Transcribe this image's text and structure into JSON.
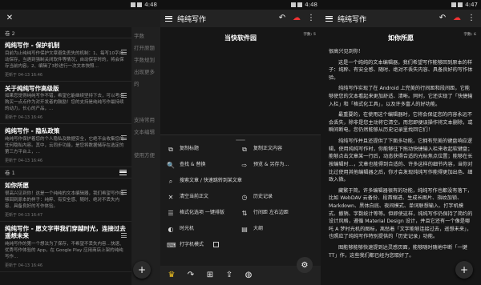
{
  "panel1": {
    "status_time": "4:48",
    "close_icon": "close-icon",
    "vol2_label": "卷 2",
    "vol1_label": "卷 1",
    "notes_vol2": [
      {
        "title": "纯纯写作 - 保护机制",
        "body": "目前为止纯纯写作保护文章避免丢失的机制：1、每写10字自动保存，当遇到强制关闭软件等情况，自动保存时的，将会保存当前内容。2、编辑了3秒进行一次文本快照…",
        "date": "更新于 04-13 16:46"
      },
      {
        "title": "关于纯纯写作高级版",
        "body": "如果您觉得纯纯写作不错，希望它能继续坚持下去，可以考虑购买一点点作为对开发者的鼓励！您的支持是纯纯写作最持续的动力，长心的产品，…",
        "date": "更新于 04-13 16:46"
      },
      {
        "title": "纯纯写作 - 隐私政策",
        "body": "纯纯写作保护着您的个人隐私及数据安全，它绝不会收集您的任何隐私内容。其中，云同步功能，是您将数据储存在选定的第三方平台上，…",
        "date": "更新于 04-13 16:46"
      }
    ],
    "notes_vol1": [
      {
        "title": "如你所愿",
        "body": "很高兴见到你！这是一个纯纯的文本编辑器，我们希望写作能够回到原本的样子：纯粹、有安全感、随时、绝对不丢失内容、具备良好的写作体验。",
        "date": "更新于 04-13 16:47"
      },
      {
        "title": "纯纯写作 - 愿文字带我们穿越时光，连接过去遥想未来",
        "body": "纯纯写作的第一个想法为了保存，不希望不丢失内容…快速、优秀写作体验的 App，在 Google Play 应用商店上架的纯纯写作…",
        "date": "更新于 04-13 16:46"
      }
    ],
    "peek_items": [
      "字数",
      "打开原题",
      "字数规划",
      "出现更多的",
      "",
      "",
      "支持常用文本编辑",
      "",
      "使用方便"
    ],
    "fab_label": "+"
  },
  "panel2": {
    "status_time": "4:48",
    "app_title": "纯纯写作",
    "doc_title": "当快软件园",
    "word_count": "字数: 5",
    "tools": [
      {
        "icon": "⧉",
        "icon_name": "copy-title-icon",
        "label": "复制标题"
      },
      {
        "icon": "⧉",
        "icon_name": "copy-body-icon",
        "label": "复制正文内容"
      },
      {
        "icon": "🔍",
        "icon_name": "find-replace-icon",
        "label": "查找 & 替换"
      },
      {
        "icon": "⇨",
        "icon_name": "preview-share-icon",
        "label": "预览 & 另存为…"
      },
      {
        "icon": "⌕",
        "icon_name": "search-jump-icon",
        "label": "搜索文章 / 快速跳转到某文章"
      },
      {
        "icon": "",
        "icon_name": "",
        "label": ""
      },
      {
        "icon": "✕",
        "icon_name": "clear-icon",
        "label": "清空当前正文"
      },
      {
        "icon": "◷",
        "icon_name": "history-icon",
        "label": "历史记录"
      },
      {
        "icon": "☰",
        "icon_name": "format-icon",
        "label": "格式化选项 一键排版"
      },
      {
        "icon": "⇅",
        "icon_name": "line-spacing-icon",
        "label": "行间距 左右边距"
      },
      {
        "icon": "◐",
        "icon_name": "time-machine-icon",
        "label": "时光机"
      },
      {
        "icon": "▤",
        "icon_name": "outline-icon",
        "label": "大纲"
      },
      {
        "icon": "⌨",
        "icon_name": "typewriter-icon",
        "label": "打字机模式"
      }
    ],
    "bottom_icons": [
      "crown-icon",
      "redo-icon",
      "add-box-icon",
      "share-icon",
      "palette-icon"
    ],
    "gear_icon": "settings-icon"
  },
  "panel3": {
    "status_time": "4:47",
    "app_title": "纯纯写作",
    "doc_title": "如你所愿",
    "word_count": "字数: 6",
    "paragraphs": [
      "很高兴见到你！",
      "这是一个纯纯的文本编辑器，我们希望写作能够回到原本的样子：纯粹、有安全感、随时、绝对不丢失内容、具备良好的写作体验。",
      "纯纯写作实现了在 Android 上完美的行间距和段间距，它能够使您的文本看起来更加舒适、清晰。同时，它还实现了「快捷输入栏」和「格式化工具」，以及许多富人的好功能。",
      "最重要的，在使用这个编辑器时，它将会保证您的内容永远不会丢失，除非是您主动将它清空。而您即便误操作将文本删除，或瞬间断电，您仍然能够从历史记录里找回它们！",
      "纯纯写作并且还提供了下面多功能，它拥有完美的键盘响应逻辑，使用纯纯写作时，你能够往下拖动快捷输入栏来收起软键盘；能够点击文章某一行后，动态获得合适的光标焦点位置；能够在长按编辑时…，文章也能得到合适的、许多这样的细节内容，当你对比过使用其他编辑器之后，你才会发现纯纯写作能得更加出色、细致入微。",
      "藏繁于简。许多编辑器很有的功能，纯纯写作也都没有落下，比如 WebDAV 云备份、段首缩进、生成长图片、指纹加锁、Markdown、黑体白底、夜间模式、单词联想输入、打字机模式、撤销、字数统计等等。但即使这样，纯纯写作仍保持了简约的设计风格，遵循 Material Design 设计，并且它还有一个像是哪吒 A 梦时光机的图标，离愁着「文字能够连接过去，遥想未来」，也照应了纯纯写作特别提供的「历史记录」功能。",
      "图能够能够快速提到达灵感页面，能够随时随地中断「一键 TT」作，这些我们都已经为您取好了。"
    ],
    "fab_label": "+"
  }
}
